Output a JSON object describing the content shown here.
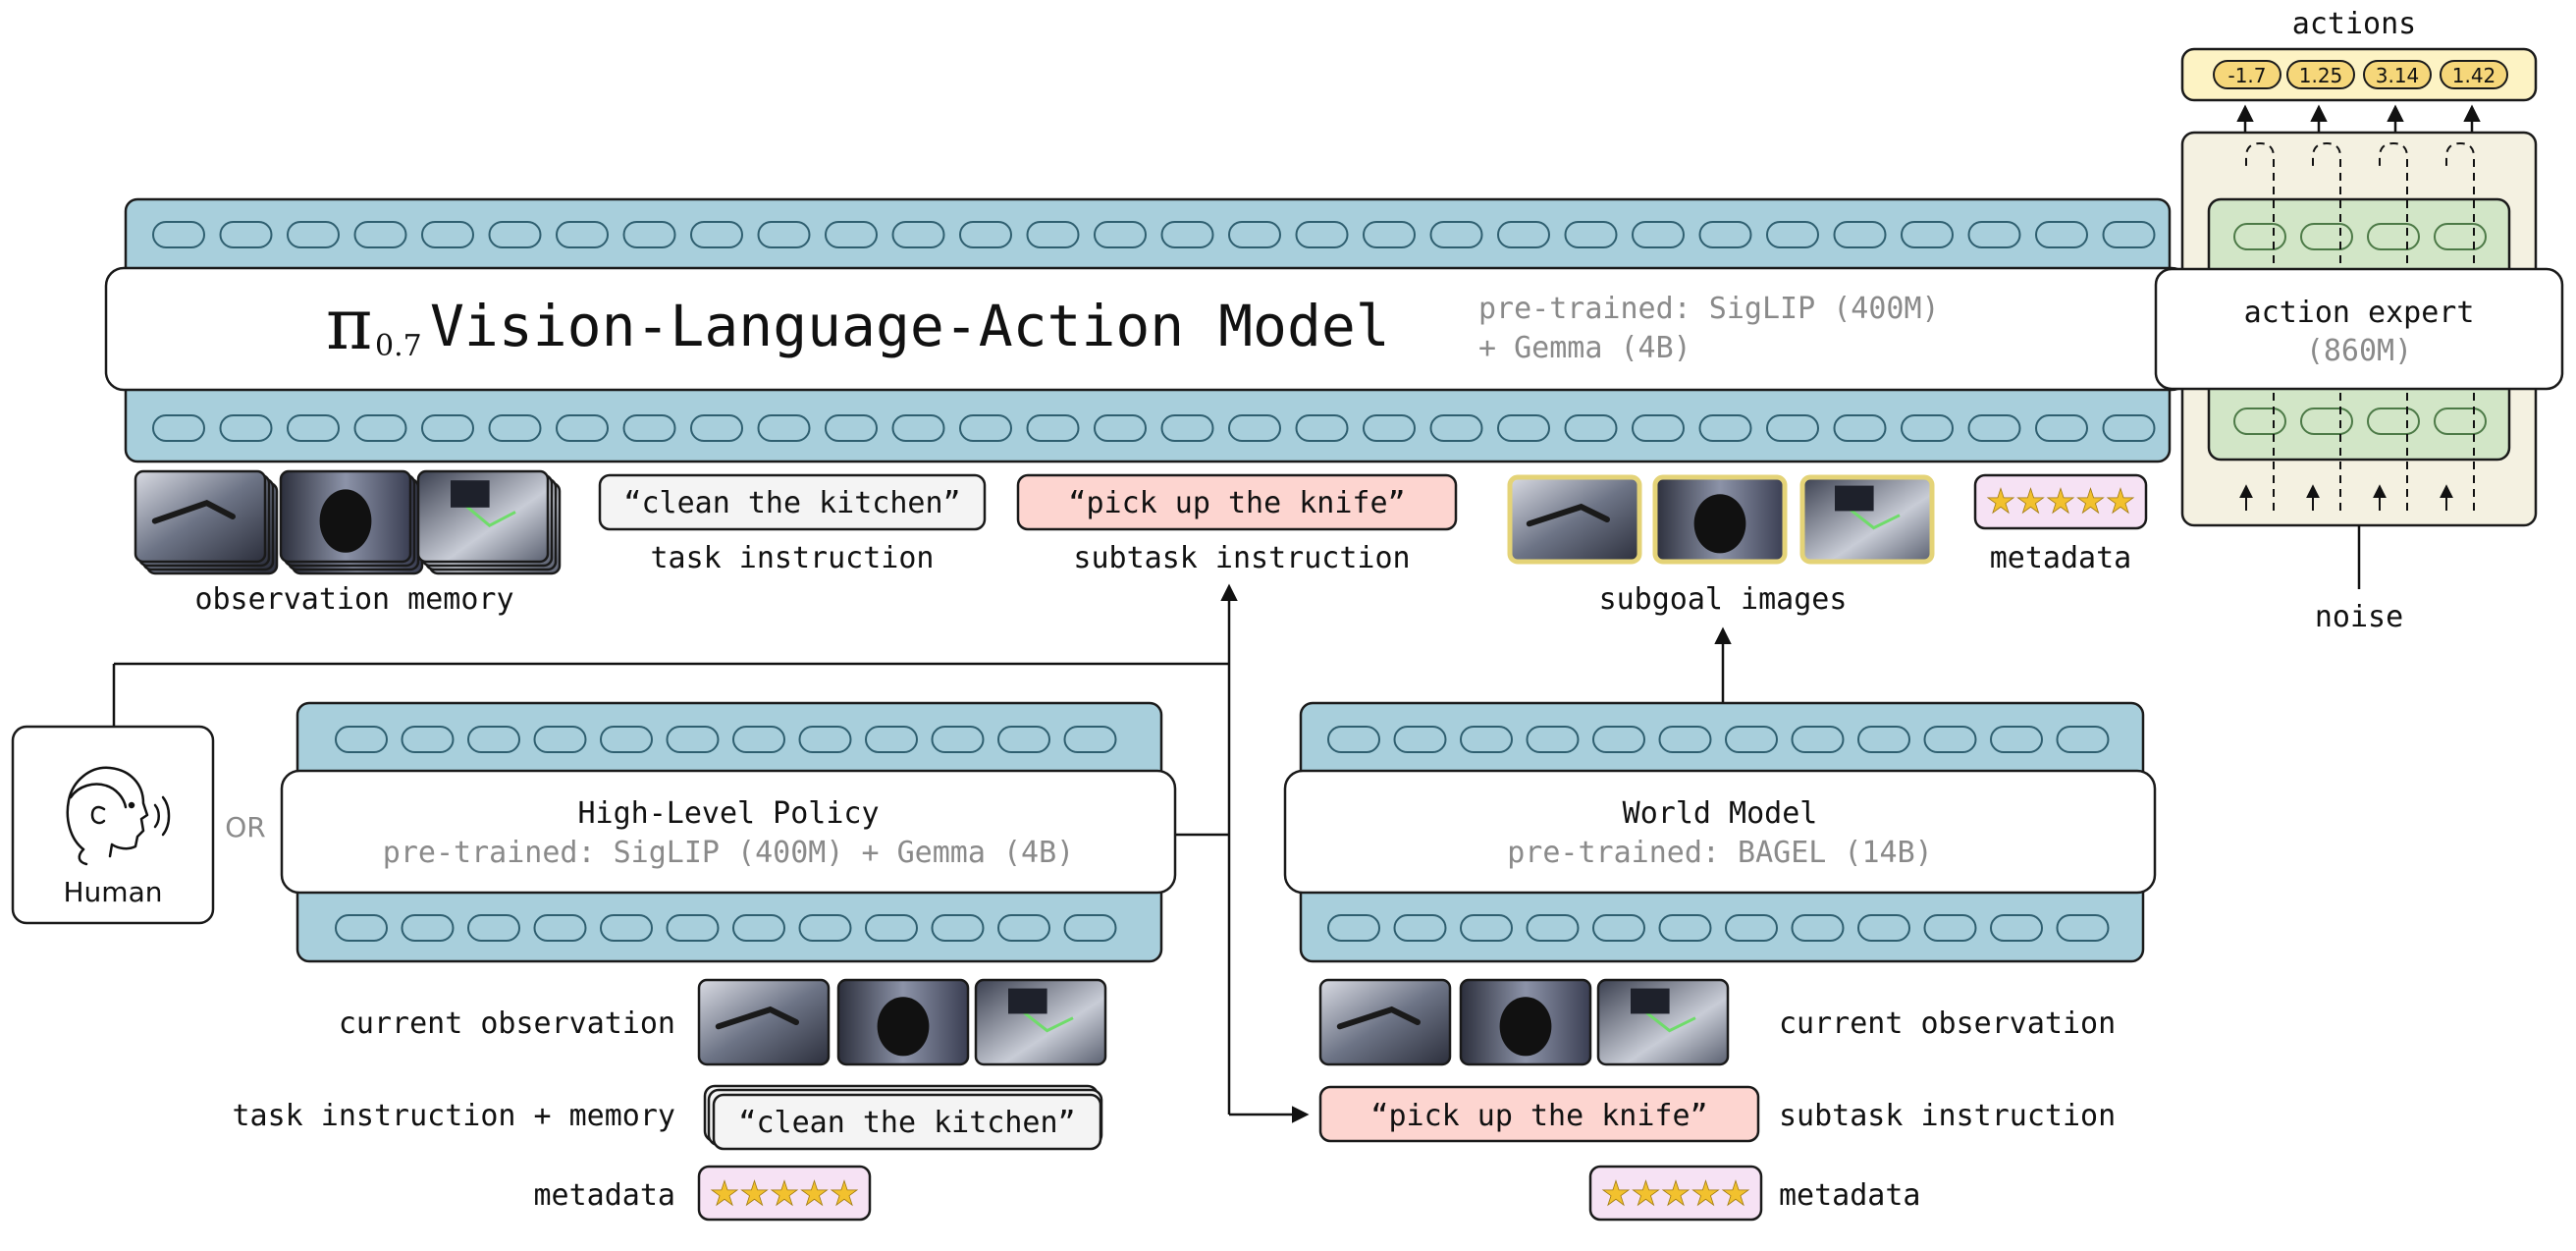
{
  "vla": {
    "title_pi": "π",
    "title_sub": "0.7",
    "title_main": "Vision-Language-Action Model",
    "pretrained_line1": "pre-trained: SigLIP (400M)",
    "pretrained_line2": "+ Gemma (4B)"
  },
  "action_expert": {
    "label": "action expert",
    "size": "(860M)"
  },
  "actions": {
    "label": "actions",
    "values": [
      "-1.7",
      "1.25",
      "3.14",
      "1.42"
    ]
  },
  "noise": {
    "label": "noise"
  },
  "inputs": {
    "observation_memory": "observation memory",
    "task_text": "“clean the kitchen”",
    "task_label": "task instruction",
    "subtask_text": "“pick up the knife”",
    "subtask_label": "subtask instruction",
    "subgoal_label": "subgoal images",
    "metadata_label": "metadata",
    "stars": "★★★★★"
  },
  "human": {
    "label": "Human",
    "or": "OR"
  },
  "high_level_policy": {
    "title": "High-Level Policy",
    "pretrained": "pre-trained: SigLIP (400M) + Gemma (4B)",
    "current_observation": "current observation",
    "task_memory_label": "task instruction + memory",
    "task_text": "“clean the kitchen”",
    "metadata_label": "metadata"
  },
  "world_model": {
    "title": "World Model",
    "pretrained": "pre-trained: BAGEL (14B)",
    "current_observation": "current observation",
    "subtask_text": "“pick up the knife”",
    "subtask_label": "subtask instruction",
    "metadata_label": "metadata"
  },
  "colors": {
    "token_band": "#a8cfdc",
    "action_panel": "#f4f1e1",
    "expert_green": "#d2e6c7",
    "actions_bg": "#fdf3c4",
    "subtask_pink": "#fdd5d0",
    "task_gray": "#f4f4f4",
    "metadata_pink": "#f6e2f4",
    "subgoal_border": "#e4d377",
    "gray_text": "#8a8a8a"
  }
}
